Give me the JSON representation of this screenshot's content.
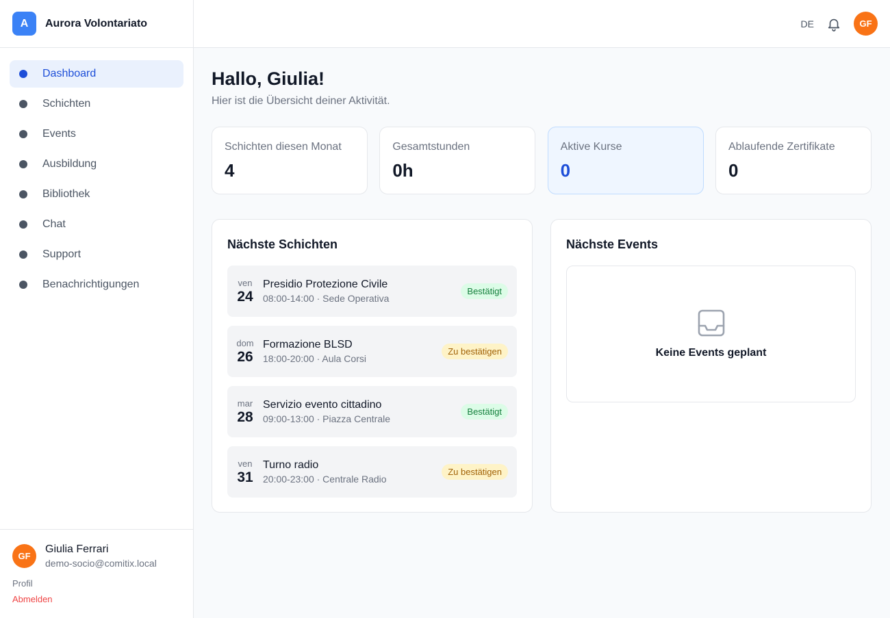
{
  "brand": {
    "logo_letter": "A",
    "name": "Aurora Volontariato"
  },
  "nav": {
    "items": [
      {
        "label": "Dashboard",
        "active": true
      },
      {
        "label": "Schichten"
      },
      {
        "label": "Events"
      },
      {
        "label": "Ausbildung"
      },
      {
        "label": "Bibliothek"
      },
      {
        "label": "Chat"
      },
      {
        "label": "Support"
      },
      {
        "label": "Benachrichtigungen"
      }
    ]
  },
  "user": {
    "initials": "GF",
    "name": "Giulia Ferrari",
    "email": "demo-socio@comitix.local",
    "profile_label": "Profil",
    "logout_label": "Abmelden"
  },
  "topbar": {
    "language": "DE",
    "bell_icon": "bell-icon",
    "avatar_initials": "GF"
  },
  "header": {
    "greeting": "Hallo, Giulia!",
    "subtitle": "Hier ist die Übersicht deiner Aktivität."
  },
  "stats": [
    {
      "label": "Schichten diesen Monat",
      "value": "4"
    },
    {
      "label": "Gesamtstunden",
      "value": "0h"
    },
    {
      "label": "Aktive Kurse",
      "value": "0",
      "highlight": true
    },
    {
      "label": "Ablaufende Zertifikate",
      "value": "0"
    }
  ],
  "shifts": {
    "title": "Nächste Schichten",
    "items": [
      {
        "dow": "ven",
        "day": "24",
        "title": "Presidio Protezione Civile",
        "meta": "08:00-14:00 · Sede Operativa",
        "status": "Bestätigt",
        "status_type": "ok"
      },
      {
        "dow": "dom",
        "day": "26",
        "title": "Formazione BLSD",
        "meta": "18:00-20:00 · Aula Corsi",
        "status": "Zu bestätigen",
        "status_type": "pending"
      },
      {
        "dow": "mar",
        "day": "28",
        "title": "Servizio evento cittadino",
        "meta": "09:00-13:00 · Piazza Centrale",
        "status": "Bestätigt",
        "status_type": "ok"
      },
      {
        "dow": "ven",
        "day": "31",
        "title": "Turno radio",
        "meta": "20:00-23:00 · Centrale Radio",
        "status": "Zu bestätigen",
        "status_type": "pending"
      }
    ]
  },
  "events": {
    "title": "Nächste Events",
    "empty_icon": "inbox-icon",
    "empty_text": "Keine Events geplant"
  },
  "colors": {
    "accent": "#1d4ed8",
    "brand": "#3b82f6",
    "avatar": "#f97316",
    "confirmed_bg": "#dcfce7",
    "pending_bg": "#fef3c7",
    "logout": "#ef4444"
  }
}
